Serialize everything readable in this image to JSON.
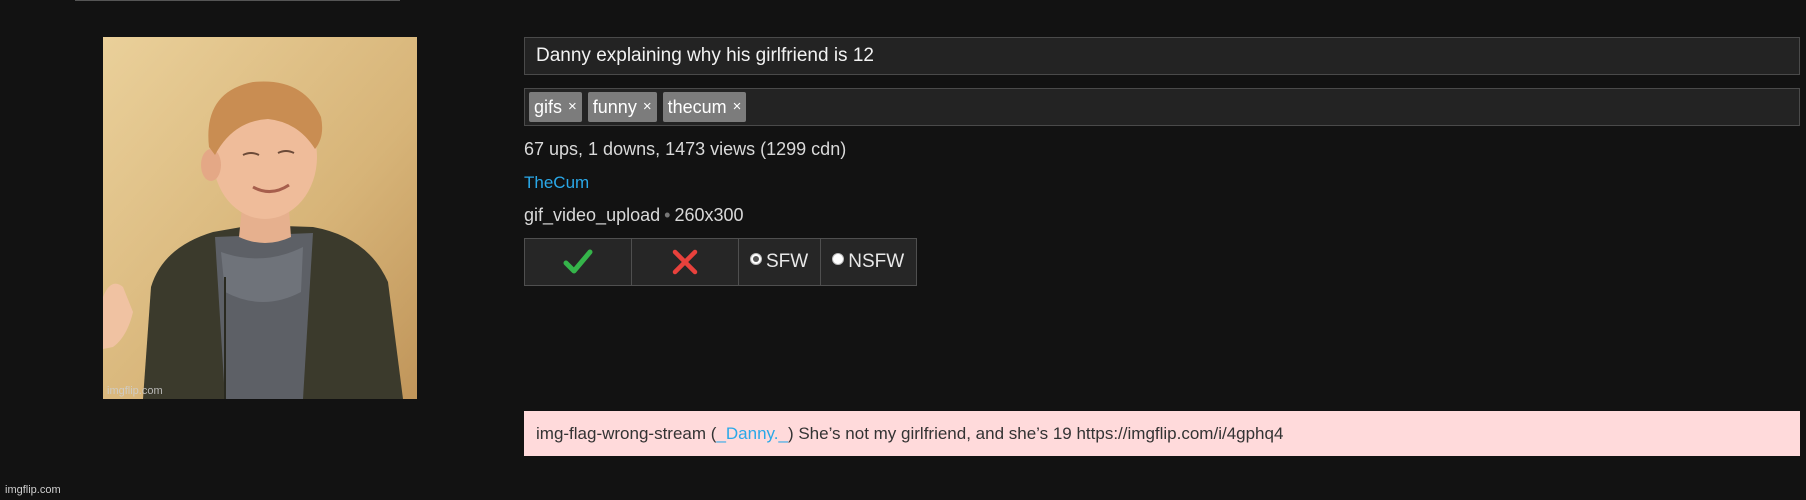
{
  "post": {
    "title": "Danny explaining why his girlfriend is 12",
    "tags": [
      {
        "label": "gifs",
        "remove": "×"
      },
      {
        "label": "funny",
        "remove": "×"
      },
      {
        "label": "thecum",
        "remove": "×"
      }
    ],
    "stats": "67 ups, 1 downs, 1473 views (1299 cdn)",
    "username": "TheCum",
    "type": "gif_video_upload",
    "separator": "•",
    "dimensions": "260x300",
    "thumbnail_watermark": "imgflip.com"
  },
  "actions": {
    "approve_icon": "checkmark-icon",
    "reject_icon": "x-mark-icon",
    "approve_color": "#35b44a",
    "reject_color": "#e8413c",
    "sfw_label": "SFW",
    "nsfw_label": "NSFW",
    "selected": "SFW"
  },
  "flag": {
    "prefix": "img-flag-wrong-stream (",
    "user": "_Danny._",
    "suffix": ") She’s not my girlfriend, and she’s 19 https://imgflip.com/i/4gphq4"
  },
  "footer": {
    "watermark": "imgflip.com"
  }
}
